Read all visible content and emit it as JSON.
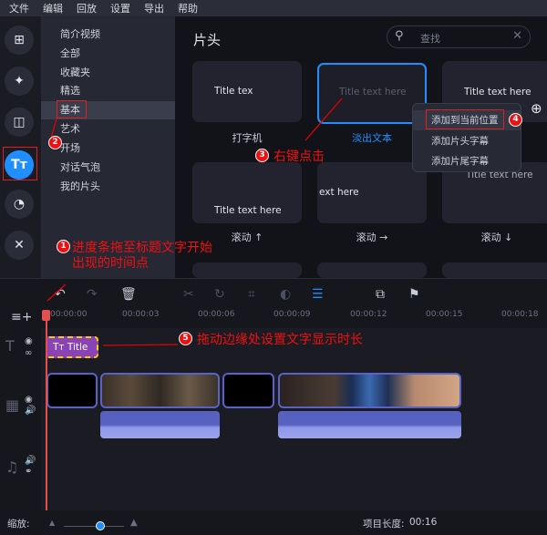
{
  "menu": [
    "文件",
    "编辑",
    "回放",
    "设置",
    "导出",
    "帮助"
  ],
  "categories": [
    "简介视频",
    "全部",
    "收藏夹",
    "精选",
    "基本",
    "艺术",
    "开场",
    "对话气泡",
    "我的片头"
  ],
  "selected_category": "基本",
  "header": {
    "title": "片头",
    "search_placeholder": "查找"
  },
  "tiles": [
    {
      "text": "Title tex",
      "label": "打字机"
    },
    {
      "text": "Title text here",
      "label": "淡出文本"
    },
    {
      "text": "Title text here",
      "label": ""
    },
    {
      "text": "Title text here",
      "label": "滚动 ↑"
    },
    {
      "text": "ext here",
      "label": "滚动 →"
    },
    {
      "text": "Title text here",
      "label": "滚动 ↓"
    }
  ],
  "context_menu": [
    "添加到当前位置",
    "添加片头字幕",
    "添加片尾字幕"
  ],
  "annotations": {
    "a1_line1": "进度条拖至标题文字开始",
    "a1_line2": "出现的时间点",
    "a3": "右键点击",
    "a5": "拖动边缘处设置文字显示时长",
    "b1": "1",
    "b2": "2",
    "b3": "3",
    "b4": "4",
    "b5": "5"
  },
  "ruler": [
    "00:00:00",
    "00:00:03",
    "00:00:06",
    "00:00:09",
    "00:00:12",
    "00:00:15",
    "00:00:18"
  ],
  "title_clip": {
    "icon": "Tт",
    "label": "Title"
  },
  "footer": {
    "zoom_label": "缩放:",
    "zoom_level": 0.6,
    "project_length_label": "项目长度:",
    "project_length": "00:16"
  },
  "icons": {
    "menu_add": "⊞",
    "zoom_in": "⊕"
  }
}
